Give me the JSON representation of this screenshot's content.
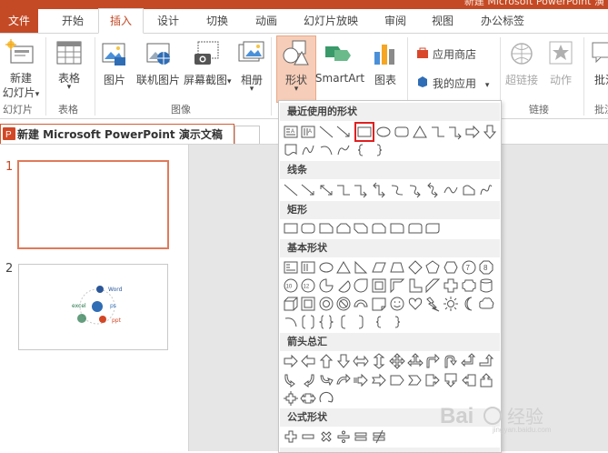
{
  "window": {
    "title": "新建 Microsoft PowerPoint 演"
  },
  "tabs": [
    {
      "label": "文件"
    },
    {
      "label": "开始"
    },
    {
      "label": "插入"
    },
    {
      "label": "设计"
    },
    {
      "label": "切换"
    },
    {
      "label": "动画"
    },
    {
      "label": "幻灯片放映"
    },
    {
      "label": "审阅"
    },
    {
      "label": "视图"
    },
    {
      "label": "办公标签"
    }
  ],
  "ribbon": {
    "new_slide": {
      "line1": "新建",
      "line2": "幻灯片",
      "dropdown": "▾"
    },
    "table": {
      "label": "表格",
      "dropdown": "▾"
    },
    "picture": {
      "label": "图片"
    },
    "online_picture": {
      "label": "联机图片"
    },
    "screenshot": {
      "label": "屏幕截图",
      "dropdown": "▾"
    },
    "album": {
      "label": "相册",
      "dropdown": "▾"
    },
    "shapes": {
      "label": "形状",
      "dropdown": "▾"
    },
    "smartart": {
      "label": "SmartArt"
    },
    "chart": {
      "label": "图表"
    },
    "app_store": {
      "label": "应用商店"
    },
    "my_apps": {
      "label": "我的应用",
      "dropdown": "▾"
    },
    "hyperlink": {
      "label": "超链接"
    },
    "action": {
      "label": "动作"
    },
    "annotate": {
      "label": "批注"
    },
    "groups": {
      "slides": "幻灯片",
      "tables": "表格",
      "images": "图像",
      "links": "链接",
      "comments": "批注"
    }
  },
  "document_tab": {
    "label": "新建 Microsoft PowerPoint 演示文稿"
  },
  "slides": [
    {
      "number": "1"
    },
    {
      "number": "2",
      "thumbnail_labels": {
        "word": "Word",
        "ps": "ps",
        "excel": "excel",
        "ppt": "ppt"
      }
    }
  ],
  "shapes_panel": {
    "categories": [
      {
        "label": "最近使用的形状"
      },
      {
        "label": "线条"
      },
      {
        "label": "矩形"
      },
      {
        "label": "基本形状"
      },
      {
        "label": "箭头总汇"
      },
      {
        "label": "公式形状"
      }
    ],
    "selected_shape": "rectangle"
  },
  "watermark": {
    "text": "Bai 经验",
    "sub": "jingyan.baidu.com"
  },
  "colors": {
    "accent": "#c44a25",
    "highlight": "#e02020",
    "panel_header": "#f0f0f0"
  }
}
